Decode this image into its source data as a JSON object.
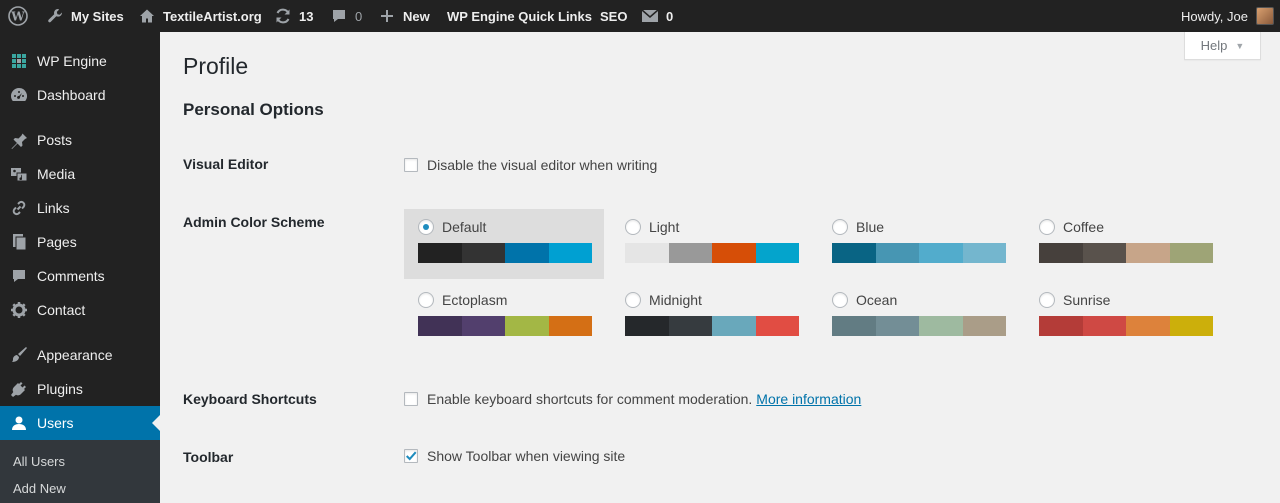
{
  "adminbar": {
    "my_sites": "My Sites",
    "site_name": "TextileArtist.org",
    "updates_count": "13",
    "comments_count": "0",
    "new_label": "New",
    "quick_links": "WP Engine Quick Links",
    "seo": "SEO",
    "messages_count": "0",
    "howdy": "Howdy, Joe"
  },
  "sidebar": {
    "items": [
      {
        "label": "WP Engine",
        "icon": "grid-icon"
      },
      {
        "label": "Dashboard",
        "icon": "dashboard-icon"
      },
      {
        "label": "Posts",
        "icon": "pin-icon"
      },
      {
        "label": "Media",
        "icon": "media-icon"
      },
      {
        "label": "Links",
        "icon": "link-icon"
      },
      {
        "label": "Pages",
        "icon": "pages-icon"
      },
      {
        "label": "Comments",
        "icon": "comment-icon"
      },
      {
        "label": "Contact",
        "icon": "gear-icon"
      },
      {
        "label": "Appearance",
        "icon": "brush-icon"
      },
      {
        "label": "Plugins",
        "icon": "plug-icon"
      },
      {
        "label": "Users",
        "icon": "user-icon"
      }
    ],
    "submenu": [
      "All Users",
      "Add New"
    ]
  },
  "help": {
    "label": "Help"
  },
  "page": {
    "title": "Profile",
    "section": "Personal Options",
    "visual_editor": {
      "label": "Visual Editor",
      "option": "Disable the visual editor when writing",
      "checked": false
    },
    "color_scheme": {
      "label": "Admin Color Scheme",
      "selected": "Default",
      "schemes": [
        {
          "name": "Default",
          "colors": [
            "#222222",
            "#333333",
            "#0073aa",
            "#00a0d2"
          ]
        },
        {
          "name": "Light",
          "colors": [
            "#e5e5e5",
            "#999999",
            "#d64e07",
            "#04a4cc"
          ]
        },
        {
          "name": "Blue",
          "colors": [
            "#096484",
            "#4796b3",
            "#52accc",
            "#74b6ce"
          ]
        },
        {
          "name": "Coffee",
          "colors": [
            "#46403c",
            "#59524c",
            "#c7a589",
            "#9ea476"
          ]
        },
        {
          "name": "Ectoplasm",
          "colors": [
            "#413256",
            "#523f6d",
            "#a3b745",
            "#d46f15"
          ]
        },
        {
          "name": "Midnight",
          "colors": [
            "#25282b",
            "#363b3f",
            "#69a8bb",
            "#e14d43"
          ]
        },
        {
          "name": "Ocean",
          "colors": [
            "#627c83",
            "#738e96",
            "#9ebaa0",
            "#aa9d88"
          ]
        },
        {
          "name": "Sunrise",
          "colors": [
            "#b43c38",
            "#cf4944",
            "#dd823b",
            "#ccaf0b"
          ]
        }
      ]
    },
    "keyboard": {
      "label": "Keyboard Shortcuts",
      "option": "Enable keyboard shortcuts for comment moderation.",
      "link": "More information",
      "checked": false
    },
    "toolbar": {
      "label": "Toolbar",
      "option": "Show Toolbar when viewing site",
      "checked": true
    }
  }
}
